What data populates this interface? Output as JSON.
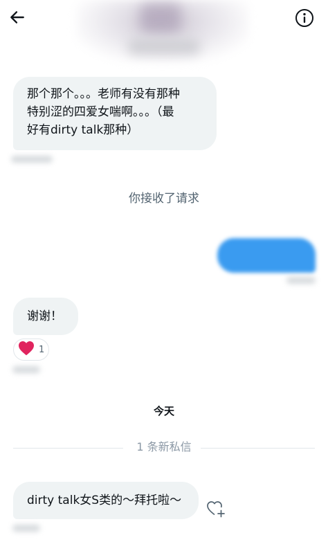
{
  "header": {
    "back_icon": "arrow-left-icon",
    "info_icon": "info-circle-icon"
  },
  "messages": {
    "first": {
      "lines": [
        "那个那个。。。老师有没有那种",
        "特别涩的四爱女喘啊。。。（最",
        "好有dirty talk那种）"
      ]
    },
    "accepted_notice": "你接收了请求",
    "thanks": "谢谢！",
    "reaction": {
      "icon": "heart-icon",
      "count": "1",
      "color": "#e0245e"
    },
    "today_label": "今天",
    "new_messages_label": "1 条新私信",
    "last": "dirty talk女S类的～拜托啦～",
    "add_reaction_icon": "heart-plus-icon"
  },
  "colors": {
    "incoming_bubble": "#eff3f4",
    "outgoing_bubble": "#3a9bf0",
    "secondary_text": "#536471"
  }
}
